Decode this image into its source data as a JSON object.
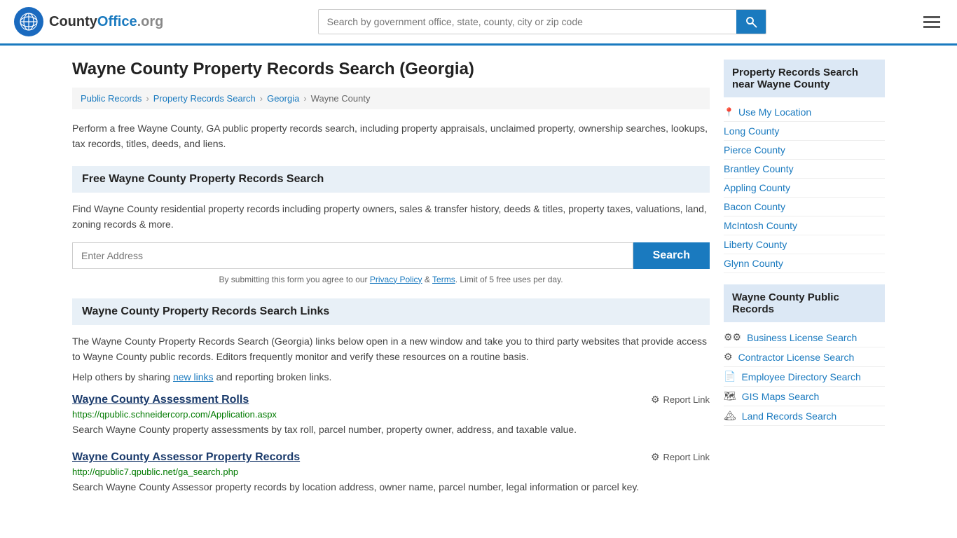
{
  "header": {
    "logo_text": "County",
    "logo_org": "Office",
    "logo_tld": ".org",
    "search_placeholder": "Search by government office, state, county, city or zip code"
  },
  "page": {
    "title": "Wayne County Property Records Search (Georgia)",
    "description": "Perform a free Wayne County, GA public property records search, including property appraisals, unclaimed property, ownership searches, lookups, tax records, titles, deeds, and liens."
  },
  "breadcrumb": {
    "items": [
      "Public Records",
      "Property Records Search",
      "Georgia",
      "Wayne County"
    ]
  },
  "free_search_section": {
    "heading": "Free Wayne County Property Records Search",
    "description": "Find Wayne County residential property records including property owners, sales & transfer history, deeds & titles, property taxes, valuations, land, zoning records & more.",
    "input_placeholder": "Enter Address",
    "search_button_label": "Search",
    "disclaimer": "By submitting this form you agree to our",
    "privacy_policy_label": "Privacy Policy",
    "and_text": "&",
    "terms_label": "Terms",
    "limit_text": ". Limit of 5 free uses per day."
  },
  "links_section": {
    "heading": "Wayne County Property Records Search Links",
    "description": "The Wayne County Property Records Search (Georgia) links below open in a new window and take you to third party websites that provide access to Wayne County public records. Editors frequently monitor and verify these resources on a routine basis.",
    "sharing_text": "Help others by sharing",
    "new_links_label": "new links",
    "sharing_suffix": "and reporting broken links.",
    "links": [
      {
        "title": "Wayne County Assessment Rolls",
        "url": "https://qpublic.schneidercorp.com/Application.aspx",
        "description": "Search Wayne County property assessments by tax roll, parcel number, property owner, address, and taxable value.",
        "report_label": "Report Link"
      },
      {
        "title": "Wayne County Assessor Property Records",
        "url": "http://qpublic7.qpublic.net/ga_search.php",
        "description": "Search Wayne County Assessor property records by location address, owner name, parcel number, legal information or parcel key.",
        "report_label": "Report Link"
      }
    ]
  },
  "sidebar": {
    "nearby_section_heading": "Property Records Search near Wayne County",
    "use_my_location_label": "Use My Location",
    "nearby_counties": [
      "Long County",
      "Pierce County",
      "Brantley County",
      "Appling County",
      "Bacon County",
      "McIntosh County",
      "Liberty County",
      "Glynn County"
    ],
    "public_records_heading": "Wayne County Public Records",
    "public_records_items": [
      {
        "icon": "⚙⚙",
        "label": "Business License Search"
      },
      {
        "icon": "⚙",
        "label": "Contractor License Search"
      },
      {
        "icon": "📄",
        "label": "Employee Directory Search"
      },
      {
        "icon": "🗺",
        "label": "GIS Maps Search"
      },
      {
        "icon": "🏔",
        "label": "Land Records Search"
      }
    ]
  }
}
